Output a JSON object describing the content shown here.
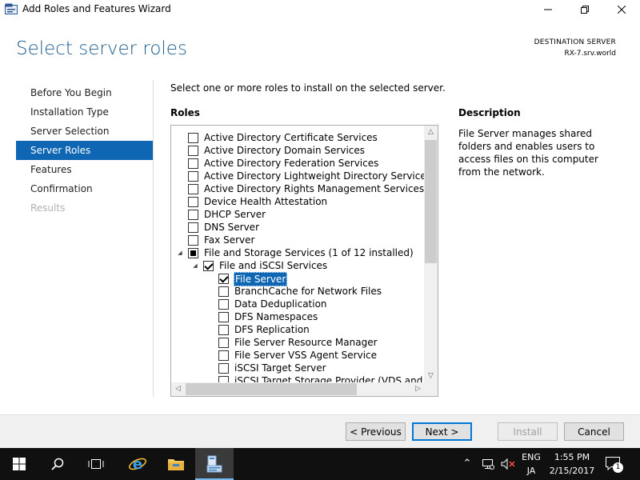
{
  "window": {
    "title": "Add Roles and Features Wizard",
    "minimize_icon": "minimize-icon",
    "maximize_icon": "restore-icon",
    "close_icon": "close-icon"
  },
  "header": {
    "title": "Select server roles",
    "destination_label": "DESTINATION SERVER",
    "destination_server": "RX-7.srv.world"
  },
  "nav": {
    "items": [
      {
        "label": "Before You Begin",
        "state": "normal"
      },
      {
        "label": "Installation Type",
        "state": "normal"
      },
      {
        "label": "Server Selection",
        "state": "normal"
      },
      {
        "label": "Server Roles",
        "state": "active"
      },
      {
        "label": "Features",
        "state": "normal"
      },
      {
        "label": "Confirmation",
        "state": "normal"
      },
      {
        "label": "Results",
        "state": "disabled"
      }
    ]
  },
  "main": {
    "instruction": "Select one or more roles to install on the selected server.",
    "roles_label": "Roles",
    "description_label": "Description",
    "description_text": "File Server manages shared folders and enables users to access files on this computer from the network.",
    "roles": [
      {
        "label": "Active Directory Certificate Services",
        "level": 0,
        "state": "unchecked",
        "expander": ""
      },
      {
        "label": "Active Directory Domain Services",
        "level": 0,
        "state": "unchecked",
        "expander": ""
      },
      {
        "label": "Active Directory Federation Services",
        "level": 0,
        "state": "unchecked",
        "expander": ""
      },
      {
        "label": "Active Directory Lightweight Directory Services",
        "level": 0,
        "state": "unchecked",
        "expander": ""
      },
      {
        "label": "Active Directory Rights Management Services",
        "level": 0,
        "state": "unchecked",
        "expander": ""
      },
      {
        "label": "Device Health Attestation",
        "level": 0,
        "state": "unchecked",
        "expander": ""
      },
      {
        "label": "DHCP Server",
        "level": 0,
        "state": "unchecked",
        "expander": ""
      },
      {
        "label": "DNS Server",
        "level": 0,
        "state": "unchecked",
        "expander": ""
      },
      {
        "label": "Fax Server",
        "level": 0,
        "state": "unchecked",
        "expander": ""
      },
      {
        "label": "File and Storage Services (1 of 12 installed)",
        "level": 0,
        "state": "partial",
        "expander": "expanded"
      },
      {
        "label": "File and iSCSI Services",
        "level": 1,
        "state": "checked",
        "expander": "expanded"
      },
      {
        "label": "File Server",
        "level": 2,
        "state": "checked",
        "expander": "",
        "selected": true
      },
      {
        "label": "BranchCache for Network Files",
        "level": 2,
        "state": "unchecked",
        "expander": ""
      },
      {
        "label": "Data Deduplication",
        "level": 2,
        "state": "unchecked",
        "expander": ""
      },
      {
        "label": "DFS Namespaces",
        "level": 2,
        "state": "unchecked",
        "expander": ""
      },
      {
        "label": "DFS Replication",
        "level": 2,
        "state": "unchecked",
        "expander": ""
      },
      {
        "label": "File Server Resource Manager",
        "level": 2,
        "state": "unchecked",
        "expander": ""
      },
      {
        "label": "File Server VSS Agent Service",
        "level": 2,
        "state": "unchecked",
        "expander": ""
      },
      {
        "label": "iSCSI Target Server",
        "level": 2,
        "state": "unchecked",
        "expander": ""
      },
      {
        "label": "iSCSI Target Storage Provider (VDS and VSS h",
        "level": 2,
        "state": "unchecked",
        "expander": ""
      }
    ]
  },
  "footer": {
    "previous_label": "< Previous",
    "next_label": "Next >",
    "install_label": "Install",
    "cancel_label": "Cancel"
  },
  "taskbar": {
    "items": [
      "start-icon",
      "search-icon",
      "task-view-icon",
      "ie-icon",
      "file-explorer-icon",
      "server-manager-icon"
    ],
    "language_1": "ENG",
    "language_2": "JA",
    "time": "1:55 PM",
    "date": "2/15/2017",
    "notification_count": "1"
  },
  "colors": {
    "accent": "#0f66b3",
    "title_blue": "#1b5a8c",
    "taskbar": "#101010"
  }
}
